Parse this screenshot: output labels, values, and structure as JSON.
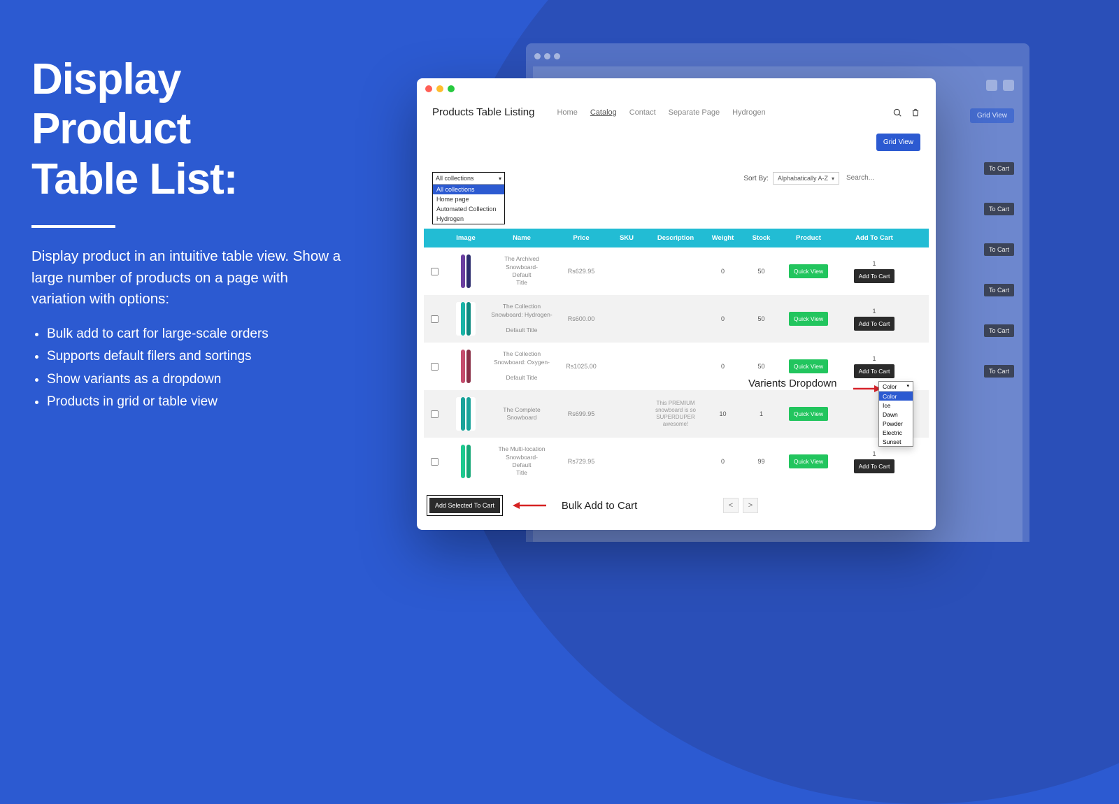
{
  "marketing": {
    "title_line1": "Display",
    "title_line2": "Product",
    "title_line3": "Table List:",
    "description": "Display product in an intuitive table view. Show a large number of products on a page with variation with options:",
    "bullets": [
      "Bulk add to cart for large-scale orders",
      "Supports default filers and sortings",
      "Show variants as a dropdown",
      "Products in grid or table view"
    ]
  },
  "header": {
    "app_title": "Products Table Listing",
    "nav": [
      "Home",
      "Catalog",
      "Contact",
      "Separate Page",
      "Hydrogen"
    ],
    "active_nav": "Catalog"
  },
  "buttons": {
    "grid_view": "Grid View",
    "quick_view": "Quick View",
    "add_to_cart": "Add To Cart",
    "add_selected": "Add Selected To Cart",
    "prev": "<",
    "next": ">"
  },
  "labels": {
    "sort_by": "Sort By:",
    "variants_dropdown": "Varients Dropdown",
    "bulk_add": "Bulk Add to Cart"
  },
  "search": {
    "placeholder": "Search..."
  },
  "collections": {
    "selected": "All collections",
    "options": [
      "All collections",
      "Home page",
      "Automated Collection",
      "Hydrogen"
    ]
  },
  "sort": {
    "selected": "Alphabatically A-Z"
  },
  "columns": [
    "",
    "Image",
    "Name",
    "Price",
    "SKU",
    "Description",
    "Weight",
    "Stock",
    "Product",
    "Add To Cart"
  ],
  "rows": [
    {
      "name": "The Archived Snowboard- Default Title",
      "price": "Rs629.95",
      "sku": "",
      "desc": "",
      "weight": "0",
      "stock": "50",
      "qty": "1",
      "colors": [
        "#6b3fa0",
        "#2d2d6e"
      ]
    },
    {
      "name": "The Collection Snowboard: Hydrogen- Default Title",
      "price": "Rs600.00",
      "sku": "",
      "desc": "",
      "weight": "0",
      "stock": "50",
      "qty": "1",
      "colors": [
        "#19b3a6",
        "#0e8a80"
      ]
    },
    {
      "name": "The Collection Snowboard: Oxygen- Default Title",
      "price": "Rs1025.00",
      "sku": "",
      "desc": "",
      "weight": "0",
      "stock": "50",
      "qty": "1",
      "colors": [
        "#c44d6d",
        "#8a2f47"
      ]
    },
    {
      "name": "The Complete Snowboard",
      "price": "Rs699.95",
      "sku": "",
      "desc": "This PREMIUM snowboard is so SUPERDUPER awesome!",
      "weight": "10",
      "stock": "1",
      "qty": "",
      "colors": [
        "#1aa39a",
        "#1aa39a"
      ]
    },
    {
      "name": "The Multi-location Snowboard- Default Title",
      "price": "Rs729.95",
      "sku": "",
      "desc": "",
      "weight": "0",
      "stock": "99",
      "qty": "1",
      "colors": [
        "#1ec98f",
        "#17a877"
      ]
    }
  ],
  "variant_dropdown": {
    "head": "Color",
    "options": [
      "Color",
      "Ice",
      "Dawn",
      "Powder",
      "Electric",
      "Sunset"
    ]
  },
  "bg_window": {
    "grid_view": "Grid View",
    "to_cart": "To Cart"
  }
}
